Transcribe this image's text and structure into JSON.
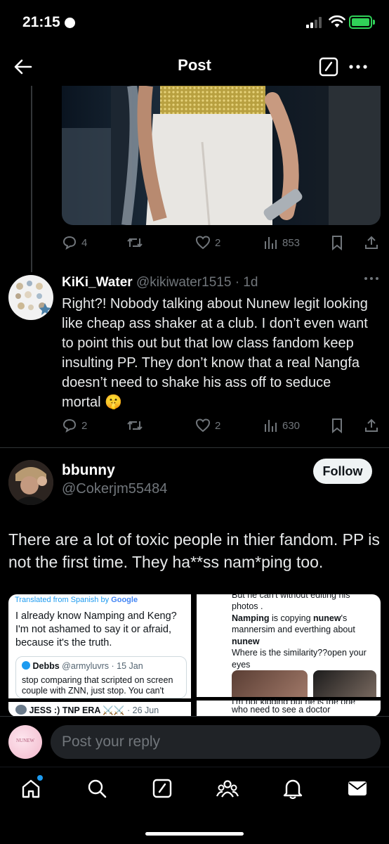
{
  "status_bar": {
    "time": "21:15"
  },
  "header": {
    "title": "Post"
  },
  "previous_post": {
    "actions": {
      "replies": "4",
      "reposts": "",
      "likes": "2",
      "views": "853"
    }
  },
  "reply1": {
    "name": "KiKi_Water",
    "handle": "@kikiwater1515",
    "time": "· 1d",
    "text": "Right?! Nobody talking about Nunew legit looking like cheap ass shaker at a club. I don’t even want to point this out but that low class fandom keep insulting PP. They don’t know that a real Nangfa doesn’t need to shake his ass off to seduce mortal 🤫",
    "actions": {
      "replies": "2",
      "reposts": "",
      "likes": "2",
      "views": "630"
    }
  },
  "featured": {
    "name": "bbunny",
    "handle": "@Cokerjm55484",
    "follow_label": "Follow",
    "text": "There are a lot of toxic people in thier fandom. PP is not the first time. They ha**ss nam*ping too."
  },
  "image_left": {
    "translated_label": "Translated from Spanish by",
    "google_label": "Google",
    "text": "I already know Namping and Keng? I'm not ashamed to say it or afraid, because it's the truth.",
    "quote_name": "Debbs",
    "quote_handle": "@armyluvrs · 15 Jan",
    "quote_text": "stop comparing that scripted on screen couple with ZNN, just stop. You can't",
    "bottom_name": "JESS :) TNP ERA ⚔️⚔️",
    "bottom_time": "· 26 Jun"
  },
  "image_right": {
    "line0": "But he can't without editing his",
    "line1": "photos .",
    "line2_bold": "Namping",
    "line2_rest": " is copying ",
    "line2_bold2": "nunew",
    "line2_end": "'s",
    "line3": "mannersim and everthing about",
    "line4_bold": "nunew",
    "line5": "Where is the similarity??open your",
    "line6": "eyes",
    "bottom_faded": "I'm not kidding but he is the one",
    "bottom": "who need to see a doctor"
  },
  "reply_bar": {
    "placeholder": "Post your reply",
    "avatar_text": "NUNEW"
  },
  "colors": {
    "accent": "#1d9bf0",
    "background": "#000000",
    "muted": "#71767b",
    "battery": "#30d158"
  },
  "icons": [
    "back-arrow-icon",
    "compose-icon",
    "more-icon",
    "reply-icon",
    "repost-icon",
    "like-icon",
    "views-icon",
    "bookmark-icon",
    "share-icon",
    "home-icon",
    "search-icon",
    "grok-icon",
    "communities-icon",
    "notifications-icon",
    "messages-icon"
  ]
}
